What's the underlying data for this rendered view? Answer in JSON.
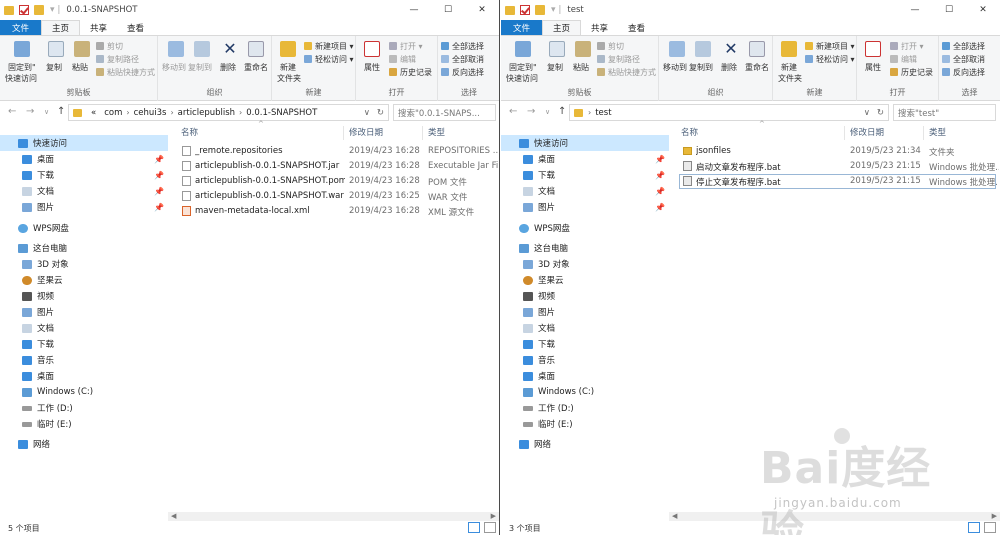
{
  "colors": {
    "accent": "#1979ca",
    "folder": "#e8b838",
    "selection": "#cce8ff"
  },
  "ribbon": {
    "tabs": [
      "文件",
      "主页",
      "共享",
      "查看"
    ],
    "clipboard": {
      "pin": "固定到\"",
      "pin2": "快速访问",
      "copy": "复制",
      "paste": "粘贴",
      "cut": "剪切",
      "copy_path": "复制路径",
      "paste_shortcut": "粘贴快捷方式",
      "label": "剪贴板"
    },
    "organize": {
      "move_to": "移动到",
      "copy_to": "复制到",
      "delete": "删除",
      "rename": "重命名",
      "label": "组织"
    },
    "new": {
      "new_folder": "新建",
      "new_folder2": "文件夹",
      "new_item": "新建项目 ▾",
      "easy_access": "轻松访问 ▾",
      "label": "新建"
    },
    "open": {
      "properties": "属性",
      "open": "打开 ▾",
      "edit": "编辑",
      "history": "历史记录",
      "label": "打开"
    },
    "select": {
      "select_all": "全部选择",
      "select_none": "全部取消",
      "invert": "反向选择",
      "label": "选择"
    }
  },
  "left": {
    "title": "0.0.1-SNAPSHOT",
    "breadcrumb": [
      "«",
      "com",
      "cehui3s",
      "articlepublish",
      "0.0.1-SNAPSHOT"
    ],
    "search_placeholder": "搜索\"0.0.1-SNAPS...",
    "status": "5 个项目",
    "columns": [
      "名称",
      "修改日期",
      "类型"
    ],
    "files": [
      {
        "name": "_remote.repositories",
        "date": "2019/4/23 16:28",
        "type": "REPOSITORIES ..."
      },
      {
        "name": "articlepublish-0.0.1-SNAPSHOT.jar",
        "date": "2019/4/23 16:28",
        "type": "Executable Jar File"
      },
      {
        "name": "articlepublish-0.0.1-SNAPSHOT.pom",
        "date": "2019/4/23 16:28",
        "type": "POM 文件"
      },
      {
        "name": "articlepublish-0.0.1-SNAPSHOT.war",
        "date": "2019/4/23 16:25",
        "type": "WAR 文件"
      },
      {
        "name": "maven-metadata-local.xml",
        "date": "2019/4/23 16:28",
        "type": "XML 源文件"
      }
    ]
  },
  "right": {
    "title": "test",
    "breadcrumb": [
      "test"
    ],
    "search_placeholder": "搜索\"test\"",
    "status": "3 个项目",
    "columns": [
      "名称",
      "修改日期",
      "类型"
    ],
    "files": [
      {
        "name": "jsonfiles",
        "date": "2019/5/23 21:34",
        "type": "文件夹"
      },
      {
        "name": "启动文章发布程序.bat",
        "date": "2019/5/23 21:15",
        "type": "Windows 批处理..."
      },
      {
        "name": "停止文章发布程序.bat",
        "date": "2019/5/23 21:15",
        "type": "Windows 批处理..."
      }
    ]
  },
  "nav": {
    "quick_access": "快速访问",
    "desktop": "桌面",
    "downloads": "下载",
    "documents": "文档",
    "pictures": "图片",
    "wps": "WPS网盘",
    "this_pc": "这台电脑",
    "objects3d": "3D 对象",
    "jianguoyun": "坚果云",
    "videos": "视频",
    "pictures2": "图片",
    "documents2": "文档",
    "downloads2": "下载",
    "music": "音乐",
    "desktop2": "桌面",
    "drive_c": "Windows (C:)",
    "drive_d": "工作 (D:)",
    "drive_e": "临时 (E:)",
    "network": "网络"
  },
  "watermark": {
    "main": "Bai度经验",
    "sub": "jingyan.baidu.com"
  }
}
